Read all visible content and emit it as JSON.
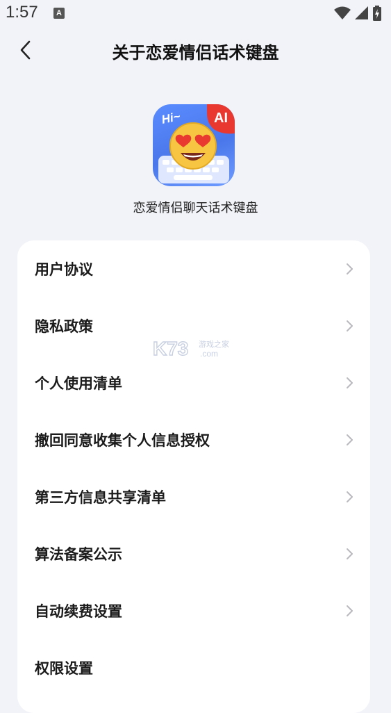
{
  "status": {
    "time": "1:57",
    "notification_icon": "a-letter-icon"
  },
  "header": {
    "title": "关于恋爱情侣话术键盘",
    "back_icon": "chevron-left-icon"
  },
  "app": {
    "icon_badge": "AI",
    "icon_greeting": "Hi~",
    "name": "恋爱情侣聊天话术键盘"
  },
  "menu": {
    "items": [
      {
        "label": "用户协议",
        "chevron": true
      },
      {
        "label": "隐私政策",
        "chevron": true
      },
      {
        "label": "个人使用清单",
        "chevron": true
      },
      {
        "label": "撤回同意收集个人信息授权",
        "chevron": true
      },
      {
        "label": "第三方信息共享清单",
        "chevron": true
      },
      {
        "label": "算法备案公示",
        "chevron": true
      },
      {
        "label": "自动续费设置",
        "chevron": true
      },
      {
        "label": "权限设置",
        "chevron": false
      }
    ]
  },
  "watermark": {
    "logo": "K73",
    "line1": "游戏之家",
    "line2": ".com"
  }
}
